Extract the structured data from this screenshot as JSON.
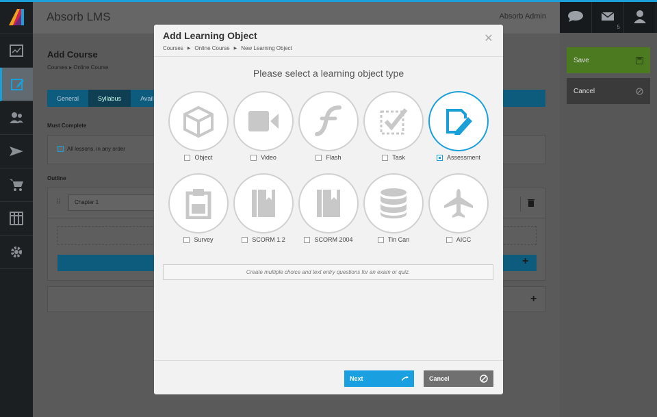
{
  "app": {
    "title": "Absorb LMS",
    "user": "Absorb Admin",
    "mail_count": "5"
  },
  "sidebar": {
    "items": [
      "dashboard-icon",
      "edit-course-icon",
      "users-icon",
      "send-icon",
      "cart-icon",
      "table-icon",
      "gear-icon"
    ]
  },
  "actions": {
    "save": "Save",
    "cancel": "Cancel"
  },
  "page": {
    "heading": "Add Course",
    "breadcrumb": [
      "Courses",
      "Online Course"
    ],
    "tabs": [
      "General",
      "Syllabus",
      "Avail"
    ],
    "must_complete_label": "Must Complete",
    "must_complete_option": "All lessons, in any order",
    "outline_label": "Outline",
    "chapter_value": "Chapter 1"
  },
  "modal": {
    "title": "Add Learning Object",
    "breadcrumb": [
      "Courses",
      "Online Course",
      "New Learning Object"
    ],
    "prompt": "Please select a learning object type",
    "types": [
      {
        "label": "Object",
        "icon": "cube-icon",
        "selected": false
      },
      {
        "label": "Video",
        "icon": "video-camera-icon",
        "selected": false
      },
      {
        "label": "Flash",
        "icon": "flash-icon",
        "selected": false
      },
      {
        "label": "Task",
        "icon": "task-checkbox-icon",
        "selected": false
      },
      {
        "label": "Assessment",
        "icon": "assessment-edit-icon",
        "selected": true
      },
      {
        "label": "Survey",
        "icon": "clipboard-icon",
        "selected": false
      },
      {
        "label": "SCORM 1.2",
        "icon": "book-icon",
        "selected": false
      },
      {
        "label": "SCORM 2004",
        "icon": "book-icon",
        "selected": false
      },
      {
        "label": "Tin Can",
        "icon": "database-icon",
        "selected": false
      },
      {
        "label": "AICC",
        "icon": "airplane-icon",
        "selected": false
      }
    ],
    "description": "Create multiple choice and text entry questions for an exam or quiz.",
    "next_label": "Next",
    "cancel_label": "Cancel"
  },
  "colors": {
    "accent": "#1aa0d8",
    "save_green": "#4c7a21",
    "next_blue": "#1aa0e0"
  }
}
